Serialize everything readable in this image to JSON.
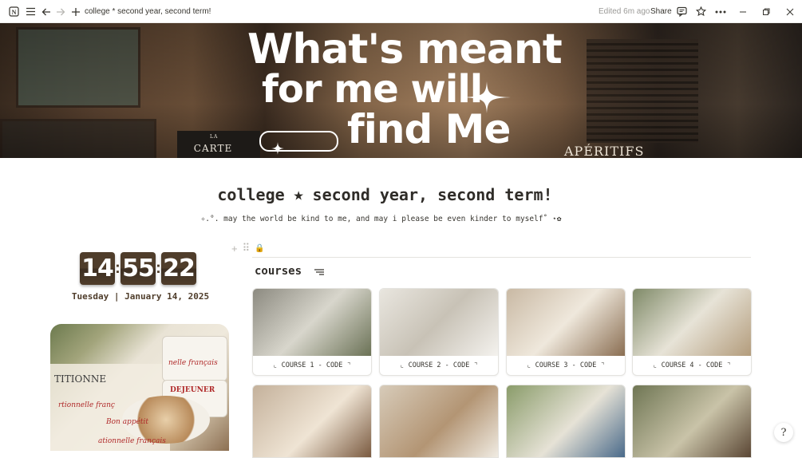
{
  "topbar": {
    "title": "college * second year, second term!",
    "edited": "Edited 6m ago",
    "share": "Share"
  },
  "cover": {
    "quote_line1": "What's meant",
    "quote_line2": "for me will",
    "quote_line3": "find Me",
    "sign_carte_small": "LA",
    "sign_carte": "CARTE",
    "sign_aperitifs": "APÉRITIFS"
  },
  "page": {
    "title": "college ⭑ second year, second term!",
    "subtitle": "✧.°. may the world be kind to me, and may i please be even kinder to myself˚ ⋆✿"
  },
  "clock": {
    "hours": "14",
    "minutes": "55",
    "seconds": "22",
    "date": "Tuesday | January 14, 2025"
  },
  "coffee_image": {
    "text1": "nelle français",
    "text2": "DEJEUNER",
    "text3": "Bon appétit",
    "text4": "rtionnelle franç",
    "text5": "ationnelle français",
    "text6": "TITIONNE"
  },
  "courses": {
    "heading": "courses",
    "cards": [
      {
        "caption": "⌞ COURSE 1 - CODE ⌝",
        "colors": [
          "#8c8a80",
          "#d8d6cc",
          "#6b7256"
        ]
      },
      {
        "caption": "⌞ COURSE 2 - CODE ⌝",
        "colors": [
          "#e9e6df",
          "#c8c2b6",
          "#f4f2ee"
        ]
      },
      {
        "caption": "⌞ COURSE 3 - CODE ⌝",
        "colors": [
          "#c9b9a4",
          "#efe8dc",
          "#8a6e52"
        ]
      },
      {
        "caption": "⌞ COURSE 4 - CODE ⌝",
        "colors": [
          "#7f8a68",
          "#e7e3d7",
          "#b39c7c"
        ]
      }
    ],
    "row2": [
      {
        "colors": [
          "#c4b19b",
          "#efe4d4",
          "#7a5a40"
        ]
      },
      {
        "colors": [
          "#d7cbb9",
          "#b39574",
          "#f0ebe2"
        ]
      },
      {
        "colors": [
          "#8a9c6a",
          "#e6e2d6",
          "#4a6a8a"
        ]
      },
      {
        "colors": [
          "#6f7654",
          "#c9c3a8",
          "#5a4634"
        ]
      }
    ]
  },
  "icons": {
    "notion": "notion-icon",
    "menu": "menu-icon",
    "back": "arrow-left-icon",
    "forward": "arrow-right-icon",
    "add": "plus-icon",
    "comment": "comment-icon",
    "star": "star-icon",
    "more": "more-icon",
    "minimize": "minimize-icon",
    "maximize": "maximize-icon",
    "close": "close-icon"
  }
}
